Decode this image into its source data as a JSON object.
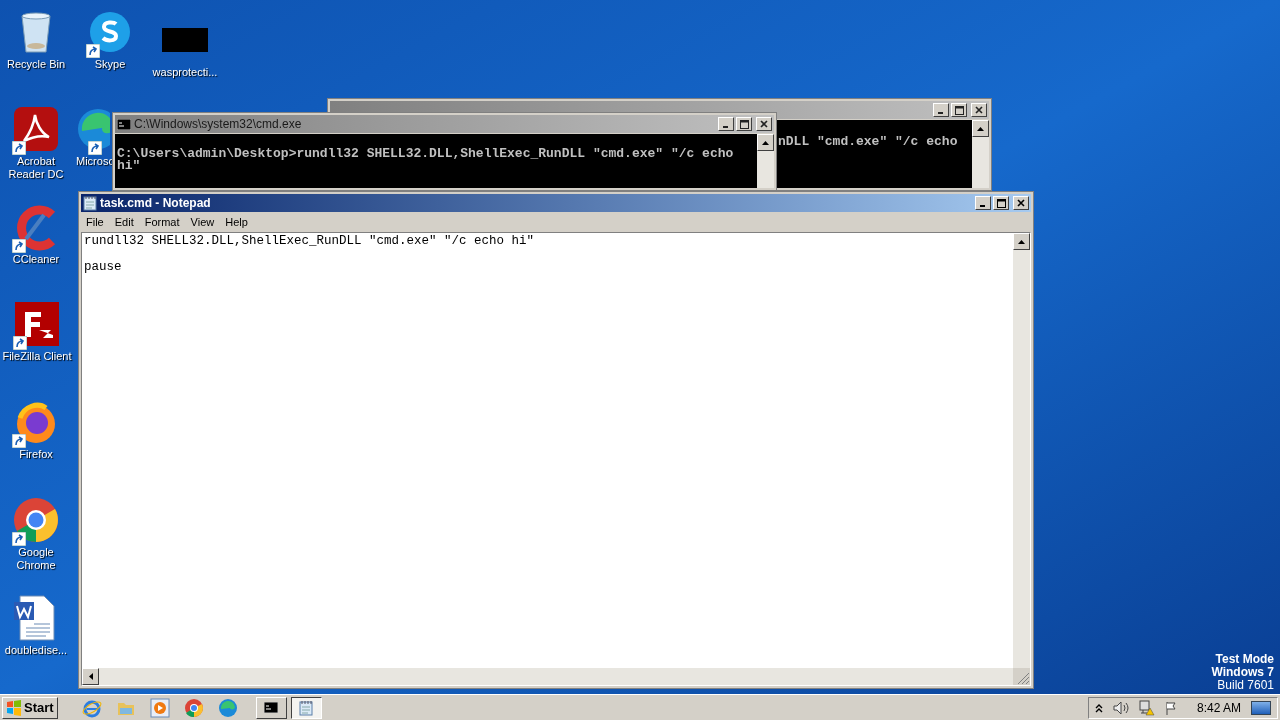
{
  "desktop_icons": [
    {
      "label": "Recycle Bin",
      "kind": "recycle-bin",
      "shortcut": false
    },
    {
      "label": "Skype",
      "kind": "skype",
      "shortcut": true
    },
    {
      "label": "wasprotecti...",
      "kind": "black-file",
      "shortcut": false
    },
    {
      "label": "Acrobat Reader DC",
      "kind": "acrobat",
      "shortcut": true
    },
    {
      "label": "Microso",
      "kind": "edge",
      "shortcut": true
    },
    {
      "label": "CCleaner",
      "kind": "ccleaner",
      "shortcut": true
    },
    {
      "label": "FileZilla Client",
      "kind": "filezilla",
      "shortcut": true
    },
    {
      "label": "Firefox",
      "kind": "firefox",
      "shortcut": true
    },
    {
      "label": "Google Chrome",
      "kind": "chrome",
      "shortcut": true
    },
    {
      "label": "doubledise...",
      "kind": "word",
      "shortcut": false
    }
  ],
  "back_console": {
    "lines": [
      "nDLL \"cmd.exe\" \"/c echo"
    ]
  },
  "console": {
    "title": "C:\\Windows\\system32\\cmd.exe",
    "blocks": [
      [
        "C:\\Users\\admin\\Desktop>rundll32 SHELL32.DLL,ShellExec_RunDLL \"cmd.exe\" \"/c echo",
        "hi\""
      ]
    ]
  },
  "notepad": {
    "title": "task.cmd - Notepad",
    "menu": [
      "File",
      "Edit",
      "Format",
      "View",
      "Help"
    ],
    "blocks": [
      [
        "rundll32 SHELL32.DLL,ShellExec_RunDLL \"cmd.exe\" \"/c echo hi\""
      ],
      [
        "pause"
      ]
    ]
  },
  "system_watermark": [
    "Test Mode",
    "Windows 7",
    "Build 7601"
  ],
  "taskbar": {
    "start": "Start",
    "quick_launch": [
      {
        "kind": "ie"
      },
      {
        "kind": "explorer"
      },
      {
        "kind": "media"
      },
      {
        "kind": "chrome"
      },
      {
        "kind": "edge"
      }
    ],
    "tasks": [
      {
        "kind": "console",
        "selected": false
      },
      {
        "kind": "notepad",
        "selected": true
      }
    ],
    "clock": "8:42 AM"
  }
}
